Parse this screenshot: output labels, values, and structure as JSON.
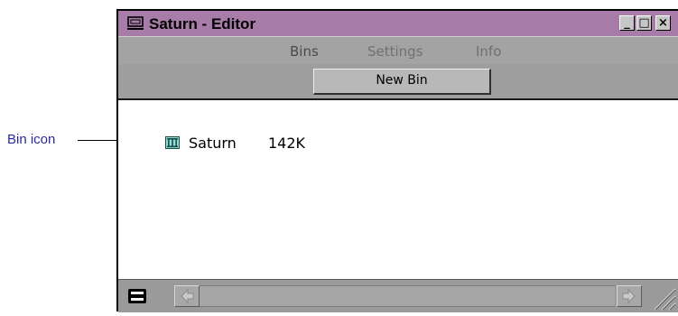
{
  "callout": {
    "label": "Bin icon"
  },
  "window": {
    "title": "Saturn - Editor",
    "controls": {
      "minimize": "_",
      "maximize": "□",
      "close": "×"
    }
  },
  "tabs": [
    {
      "label": "Bins",
      "active": true
    },
    {
      "label": "Settings",
      "active": false
    },
    {
      "label": "Info",
      "active": false
    }
  ],
  "toolbar": {
    "new_bin_label": "New Bin"
  },
  "bins": [
    {
      "name": "Saturn",
      "size": "142K",
      "icon": "bin-icon"
    }
  ],
  "icons": {
    "app": "monitor-icon",
    "view_toggle": "view-toggle-icon",
    "scroll_left": "arrow-left-icon",
    "scroll_right": "arrow-right-icon",
    "resize": "resize-grip-icon"
  },
  "colors": {
    "titlebar": "#a87ca8",
    "callout_text": "#2a2aa0"
  }
}
